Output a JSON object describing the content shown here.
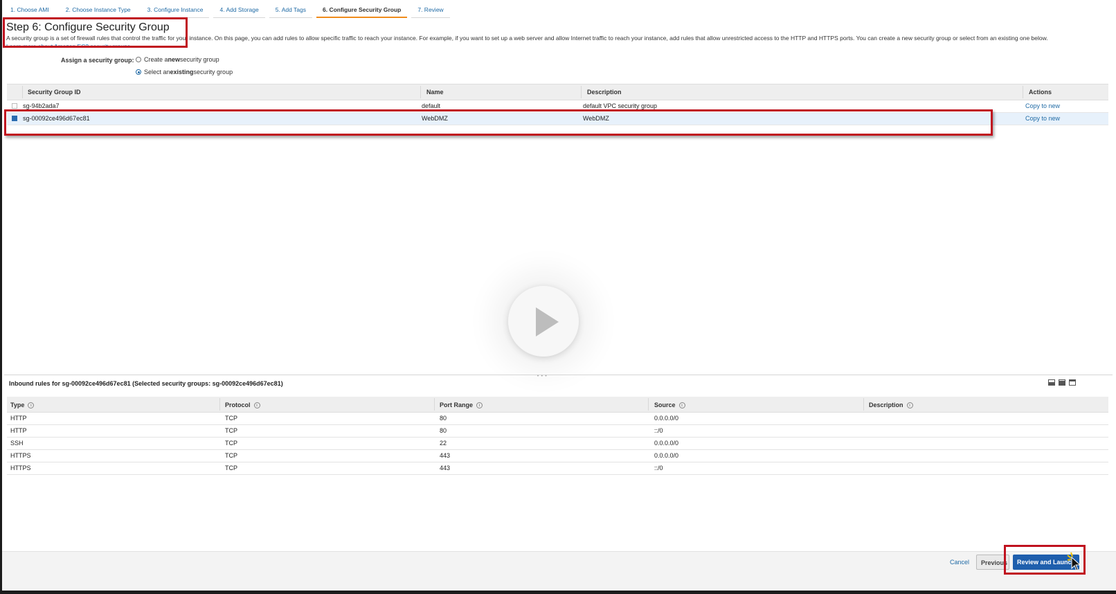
{
  "wizard": {
    "steps": [
      "1. Choose AMI",
      "2. Choose Instance Type",
      "3. Configure Instance",
      "4. Add Storage",
      "5. Add Tags",
      "6. Configure Security Group",
      "7. Review"
    ],
    "active_step": 6
  },
  "header": {
    "title": "Step 6: Configure Security Group",
    "intro": "A security group is a set of firewall rules that control the traffic for your instance. On this page, you can add rules to allow specific traffic to reach your instance. For example, if you want to set up a web server and allow Internet traffic to reach your instance, add rules that allow unrestricted access to the HTTP and HTTPS ports. You can create a new security group or select from an existing one below.",
    "learn_more": "Learn more about Amazon EC2 security groups."
  },
  "assign": {
    "label": "Assign a security group:",
    "option_new_pre": "Create a ",
    "option_new_bold": "new",
    "option_new_post": " security group",
    "option_existing_pre": "Select an ",
    "option_existing_bold": "existing",
    "option_existing_post": " security group",
    "selected": "existing"
  },
  "security_groups": {
    "columns": {
      "id": "Security Group ID",
      "name": "Name",
      "description": "Description",
      "actions": "Actions"
    },
    "rows": [
      {
        "id": "sg-94b2ada7",
        "name": "default",
        "description": "default VPC security group",
        "action": "Copy to new",
        "selected": false
      },
      {
        "id": "sg-00092ce496d67ec81",
        "name": "WebDMZ",
        "description": "WebDMZ",
        "action": "Copy to new",
        "selected": true
      }
    ]
  },
  "inbound": {
    "title": "Inbound rules for sg-00092ce496d67ec81 (Selected security groups: sg-00092ce496d67ec81)",
    "columns": {
      "type": "Type",
      "protocol": "Protocol",
      "port_range": "Port Range",
      "source": "Source",
      "description": "Description"
    },
    "info_glyph": "i",
    "rows": [
      {
        "type": "HTTP",
        "protocol": "TCP",
        "port_range": "80",
        "source": "0.0.0.0/0",
        "description": ""
      },
      {
        "type": "HTTP",
        "protocol": "TCP",
        "port_range": "80",
        "source": "::/0",
        "description": ""
      },
      {
        "type": "SSH",
        "protocol": "TCP",
        "port_range": "22",
        "source": "0.0.0.0/0",
        "description": ""
      },
      {
        "type": "HTTPS",
        "protocol": "TCP",
        "port_range": "443",
        "source": "0.0.0.0/0",
        "description": ""
      },
      {
        "type": "HTTPS",
        "protocol": "TCP",
        "port_range": "443",
        "source": "::/0",
        "description": ""
      }
    ]
  },
  "footer": {
    "cancel": "Cancel",
    "previous": "Previous",
    "review_and_launch": "Review and Launch"
  },
  "icons": {
    "video_overlay": "play-icon",
    "panel_controls": [
      "panel-bottom-icon",
      "panel-half-icon",
      "panel-full-icon"
    ],
    "pointer": "cursor-icon"
  },
  "colors": {
    "accent": "#1f6aa5",
    "active_tab_underline": "#f08c1c",
    "primary_button": "#1f5fad",
    "annotation_box": "#c0121f",
    "selected_row": "#e7f1fb"
  }
}
